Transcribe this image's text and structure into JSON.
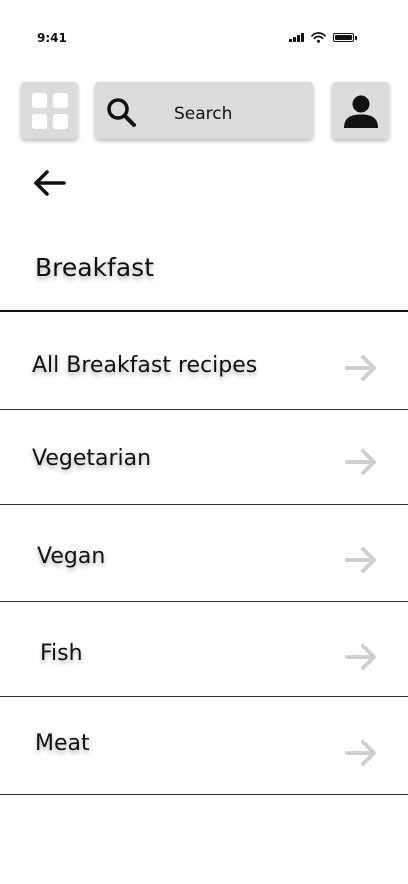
{
  "status_bar": {
    "time": "9:41"
  },
  "search": {
    "placeholder": "Search"
  },
  "page": {
    "title": "Breakfast"
  },
  "menu_items": [
    {
      "label": "All Breakfast recipes"
    },
    {
      "label": "Vegetarian"
    },
    {
      "label": "Vegan"
    },
    {
      "label": "Fish"
    },
    {
      "label": "Meat"
    }
  ],
  "colors": {
    "button_background": "#dcdcdc",
    "arrow": "#cfcfcf",
    "text": "#111111"
  }
}
